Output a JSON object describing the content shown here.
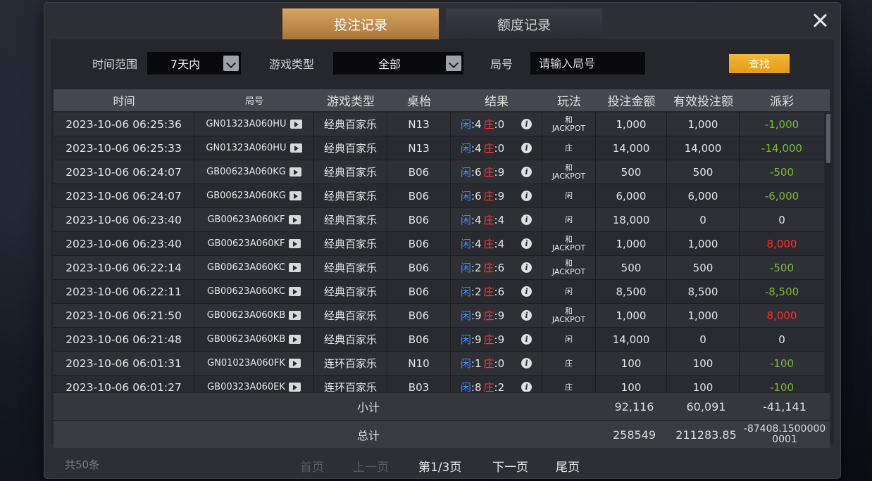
{
  "tabs": {
    "bet_records": "投注记录",
    "credit_records": "额度记录"
  },
  "filters": {
    "time_label": "时间范围",
    "time_value": "7天内",
    "game_type_label": "游戏类型",
    "game_type_value": "全部",
    "round_label": "局号",
    "round_placeholder": "请输入局号",
    "search_label": "查找"
  },
  "columns": [
    "时间",
    "局号",
    "游戏类型",
    "桌枱",
    "结果",
    "玩法",
    "投注金额",
    "有效投注额",
    "派彩"
  ],
  "result_labels": {
    "player": "闲",
    "banker": "庄"
  },
  "rows": [
    {
      "time": "2023-10-06 06:25:36",
      "round": "GN01323A060HU",
      "game": "经典百家乐",
      "table": "N13",
      "p": "4",
      "b": "0",
      "play": [
        "和",
        "JACKPOT"
      ],
      "amount": "1,000",
      "valid": "1,000",
      "payout": "-1,000",
      "payout_color": "green"
    },
    {
      "time": "2023-10-06 06:25:33",
      "round": "GN01323A060HU",
      "game": "经典百家乐",
      "table": "N13",
      "p": "4",
      "b": "0",
      "play": [
        "庄"
      ],
      "amount": "14,000",
      "valid": "14,000",
      "payout": "-14,000",
      "payout_color": "green"
    },
    {
      "time": "2023-10-06 06:24:07",
      "round": "GB00623A060KG",
      "game": "经典百家乐",
      "table": "B06",
      "p": "6",
      "b": "9",
      "play": [
        "和",
        "JACKPOT"
      ],
      "amount": "500",
      "valid": "500",
      "payout": "-500",
      "payout_color": "green"
    },
    {
      "time": "2023-10-06 06:24:07",
      "round": "GB00623A060KG",
      "game": "经典百家乐",
      "table": "B06",
      "p": "6",
      "b": "9",
      "play": [
        "闲"
      ],
      "amount": "6,000",
      "valid": "6,000",
      "payout": "-6,000",
      "payout_color": "green"
    },
    {
      "time": "2023-10-06 06:23:40",
      "round": "GB00623A060KF",
      "game": "经典百家乐",
      "table": "B06",
      "p": "4",
      "b": "4",
      "play": [
        "闲"
      ],
      "amount": "18,000",
      "valid": "0",
      "payout": "0",
      "payout_color": "white"
    },
    {
      "time": "2023-10-06 06:23:40",
      "round": "GB00623A060KF",
      "game": "经典百家乐",
      "table": "B06",
      "p": "4",
      "b": "4",
      "play": [
        "和",
        "JACKPOT"
      ],
      "amount": "1,000",
      "valid": "1,000",
      "payout": "8,000",
      "payout_color": "red"
    },
    {
      "time": "2023-10-06 06:22:14",
      "round": "GB00623A060KC",
      "game": "经典百家乐",
      "table": "B06",
      "p": "2",
      "b": "6",
      "play": [
        "和",
        "JACKPOT"
      ],
      "amount": "500",
      "valid": "500",
      "payout": "-500",
      "payout_color": "green"
    },
    {
      "time": "2023-10-06 06:22:11",
      "round": "GB00623A060KC",
      "game": "经典百家乐",
      "table": "B06",
      "p": "2",
      "b": "6",
      "play": [
        "闲"
      ],
      "amount": "8,500",
      "valid": "8,500",
      "payout": "-8,500",
      "payout_color": "green"
    },
    {
      "time": "2023-10-06 06:21:50",
      "round": "GB00623A060KB",
      "game": "经典百家乐",
      "table": "B06",
      "p": "9",
      "b": "9",
      "play": [
        "和",
        "JACKPOT"
      ],
      "amount": "1,000",
      "valid": "1,000",
      "payout": "8,000",
      "payout_color": "red"
    },
    {
      "time": "2023-10-06 06:21:48",
      "round": "GB00623A060KB",
      "game": "经典百家乐",
      "table": "B06",
      "p": "9",
      "b": "9",
      "play": [
        "闲"
      ],
      "amount": "14,000",
      "valid": "0",
      "payout": "0",
      "payout_color": "white"
    },
    {
      "time": "2023-10-06 06:01:31",
      "round": "GN01023A060FK",
      "game": "连环百家乐",
      "table": "N10",
      "p": "1",
      "b": "0",
      "play": [
        "庄"
      ],
      "amount": "100",
      "valid": "100",
      "payout": "-100",
      "payout_color": "green"
    },
    {
      "time": "2023-10-06 06:01:27",
      "round": "GB00323A060EK",
      "game": "连环百家乐",
      "table": "B03",
      "p": "8",
      "b": "2",
      "play": [
        "庄"
      ],
      "amount": "100",
      "valid": "100",
      "payout": "-100",
      "payout_color": "green"
    }
  ],
  "subtotal": {
    "label": "小计",
    "amount": "92,116",
    "valid": "60,091",
    "payout": "-41,141"
  },
  "total": {
    "label": "总计",
    "amount": "258549",
    "valid": "211283.85",
    "payout": "-87408.15000000001"
  },
  "footer": {
    "count": "共50条",
    "first": "首页",
    "prev": "上一页",
    "current": "第1/3页",
    "next": "下一页",
    "last": "尾页"
  },
  "colors": {
    "tab_active": "#c89050",
    "search_button": "#efa820",
    "player": "#3a8cff",
    "banker": "#ff3a3a",
    "payout_loss": "#7ab83a",
    "payout_win": "#ff2b2b"
  }
}
